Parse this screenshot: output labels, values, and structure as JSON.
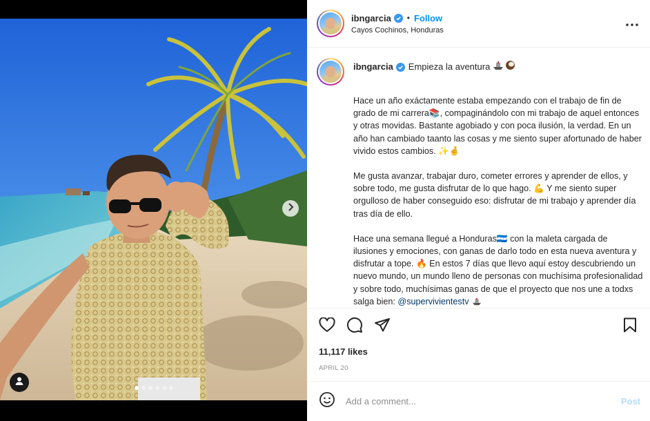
{
  "post": {
    "username": "ibngarcia",
    "follow_label": "Follow",
    "separator": "•",
    "location": "Cayos Cochinos, Honduras",
    "caption_title": "Empieza la aventura",
    "caption_paragraphs": [
      "Hace un año exáctamente estaba empezando con el trabajo de fin de grado de mi carrera📚, compaginándolo con mi trabajo de aquel entonces y otras movidas. Bastante agobiado y con poca ilusión, la verdad. En un año han cambiado taanto las cosas y me siento super afortunado de haber vivido estos cambios. ✨🤞",
      "Me gusta avanzar, trabajar duro, cometer errores y aprender de ellos, y sobre todo, me gusta disfrutar de lo que hago. 💪 Y me siento super orgulloso de haber conseguido eso: disfrutar de mi trabajo y aprender día tras día de ello.",
      "Hace una semana llegué a Honduras🇭🇳 con la maleta cargada de ilusiones y emociones, con ganas de darlo todo en esta nueva aventura y disfrutar a tope. 🔥 En estos 7 días que llevo aquí estoy descubriendo un nuevo mundo, un mundo lleno de personas con muchísima profesionalidad y sobre todo, muchísimas ganas de que el proyecto que nos une a todxs salga bien: "
    ],
    "mention": "@supervivientestv",
    "likes": "11,117 likes",
    "date": "APRIL 20",
    "comment_placeholder": "Add a comment...",
    "post_label": "Post"
  },
  "carousel": {
    "slides": 6,
    "active": 0
  },
  "icons": {
    "more": "more-options-icon",
    "next": "chevron-right-icon",
    "user_tag": "user-tag-icon",
    "like": "heart-icon",
    "comment": "comment-icon",
    "share": "share-icon",
    "save": "bookmark-icon",
    "emoji": "emoji-icon",
    "verified": "verified-badge-icon"
  },
  "colors": {
    "accent": "#0095f6",
    "verified": "#3897f0",
    "post_disabled": "#b2dffc",
    "mention": "#00376b"
  }
}
